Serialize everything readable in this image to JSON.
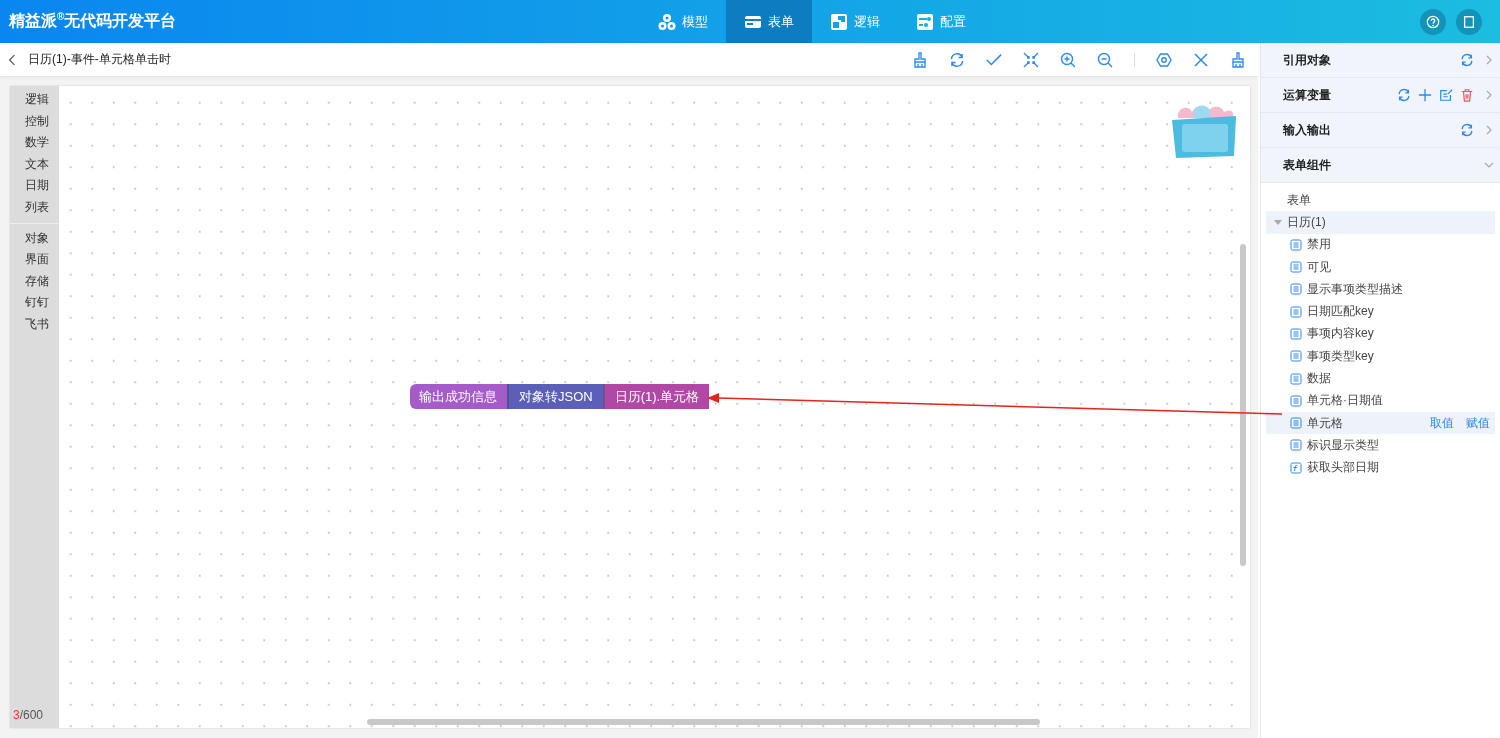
{
  "app": {
    "title": "精益派$^{®}$无代码开发平台"
  },
  "nav": [
    {
      "label": "模型",
      "selected": false
    },
    {
      "label": "表单",
      "selected": true
    },
    {
      "label": "逻辑",
      "selected": false
    },
    {
      "label": "配置",
      "selected": false
    }
  ],
  "editor": {
    "title": "日历(1)-事件-单元格单击时"
  },
  "toolbox": {
    "groups": [
      [
        "逻辑",
        "控制",
        "数学",
        "文本",
        "日期",
        "列表"
      ],
      [
        "对象",
        "界面",
        "存储",
        "钉钉",
        "飞书"
      ]
    ]
  },
  "blocks": [
    {
      "label": "输出成功信息",
      "color": "#a55bc8",
      "kind": "statement"
    },
    {
      "label": "对象转JSON",
      "color": "#5b5fb7",
      "kind": "value"
    },
    {
      "label": "日历(1).单元格",
      "color": "#b248a6",
      "kind": "value"
    }
  ],
  "block_counter": {
    "count": "3",
    "limit": "/600"
  },
  "panel": {
    "sections": [
      {
        "title": "引用对象",
        "expanded": false
      },
      {
        "title": "运算变量",
        "expanded": false
      },
      {
        "title": "输入输出",
        "expanded": false
      },
      {
        "title": "表单组件",
        "expanded": true
      }
    ],
    "tree": [
      {
        "label": "表单",
        "highlighted": false
      },
      {
        "label": "日历(1)",
        "highlighted": true,
        "expanded": true,
        "children": [
          {
            "label": "禁用",
            "kind": "field",
            "highlighted": false
          },
          {
            "label": "可见",
            "kind": "field",
            "highlighted": false
          },
          {
            "label": "显示事项类型描述",
            "kind": "field",
            "highlighted": false
          },
          {
            "label": "日期匹配key",
            "kind": "field",
            "highlighted": false
          },
          {
            "label": "事项内容key",
            "kind": "field",
            "highlighted": false
          },
          {
            "label": "事项类型key",
            "kind": "field",
            "highlighted": false
          },
          {
            "label": "数据",
            "kind": "field",
            "highlighted": false
          },
          {
            "label": "单元格·日期值",
            "kind": "field",
            "highlighted": false
          },
          {
            "label": "单元格",
            "kind": "field",
            "highlighted": true,
            "actions": [
              "取值",
              "赋值"
            ]
          },
          {
            "label": "标识显示类型",
            "kind": "field",
            "highlighted": false
          },
          {
            "label": "获取头部日期",
            "kind": "method",
            "highlighted": false
          }
        ]
      }
    ]
  }
}
